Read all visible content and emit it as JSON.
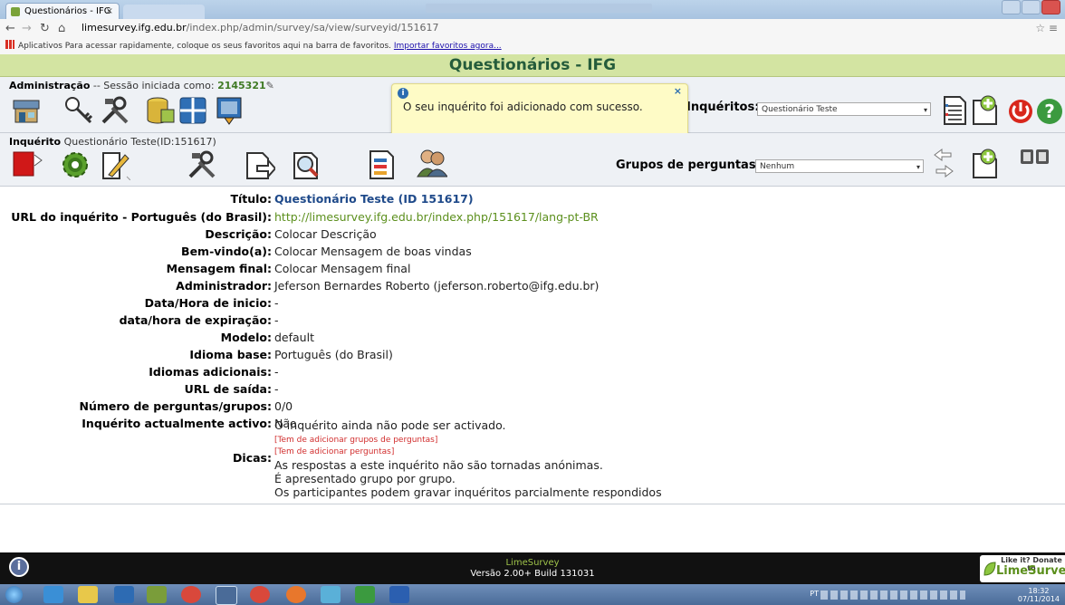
{
  "browser": {
    "tab_title": "Questionários - IFG",
    "tab_close": "×",
    "url_host": "limesurvey.ifg.edu.br",
    "url_path": "/index.php/admin/survey/sa/view/surveyid/151617",
    "bookmarks_text": "Aplicativos   Para acessar rapidamente, coloque os seus favoritos aqui na barra de favoritos.",
    "bookmarks_link": "Importar favoritos agora..."
  },
  "header": {
    "title": "Questionários - IFG"
  },
  "admin": {
    "label": "Administração",
    "session_text": " -- Sessão iniciada como: ",
    "user": "2145321",
    "surveys_label": "Inquéritos:",
    "surveys_selected": "Questionário Teste"
  },
  "notification": {
    "message": "O seu inquérito foi adicionado com sucesso.",
    "close": "×",
    "icon": "i"
  },
  "survey": {
    "label": "Inquérito",
    "name": " Questionário Teste(ID:151617)",
    "groups_label": "Grupos de perguntas:",
    "groups_selected": "Nenhum"
  },
  "details": {
    "rows": [
      {
        "label": "Título:",
        "value": "Questionário Teste (ID 151617)"
      },
      {
        "label": "URL do inquérito - Português (do Brasil):",
        "value": "http://limesurvey.ifg.edu.br/index.php/151617/lang-pt-BR"
      },
      {
        "label": "Descrição:",
        "value": "Colocar Descrição"
      },
      {
        "label": "Bem-vindo(a):",
        "value": "Colocar Mensagem de boas vindas"
      },
      {
        "label": "Mensagem final:",
        "value": "Colocar Mensagem final"
      },
      {
        "label": "Administrador:",
        "value": "Jeferson Bernardes Roberto (jeferson.roberto@ifg.edu.br)"
      },
      {
        "label": "Data/Hora de inicio:",
        "value": "-"
      },
      {
        "label": "data/hora de expiração:",
        "value": "-"
      },
      {
        "label": "Modelo:",
        "value": "default"
      },
      {
        "label": "Idioma base:",
        "value": "Português (do Brasil)"
      },
      {
        "label": "Idiomas adicionais:",
        "value": "-"
      },
      {
        "label": "URL de saída:",
        "value": "-"
      },
      {
        "label": "Número de perguntas/grupos:",
        "value": "0/0"
      },
      {
        "label": "Inquérito actualmente activo:",
        "value": "Não"
      }
    ],
    "dicas_label": "Dicas:",
    "dicas": {
      "l1": "O inquérito ainda não pode ser activado.",
      "w1": "[Tem de adicionar grupos de perguntas]",
      "w2": "[Tem de adicionar perguntas]",
      "l2": "As respostas a este inquérito não são tornadas anónimas.",
      "l3": "É apresentado grupo por grupo.",
      "l4": "Os participantes podem gravar inquéritos parcialmente respondidos"
    }
  },
  "footer": {
    "brand": "LimeSurvey",
    "version": "Versão 2.00+ Build 131031",
    "donate_top": "Like it? Donate to",
    "donate_brand": "LimeSurvey"
  },
  "taskbar": {
    "clock_time": "18:32",
    "clock_date": "07/11/2014",
    "lang": "PT"
  }
}
